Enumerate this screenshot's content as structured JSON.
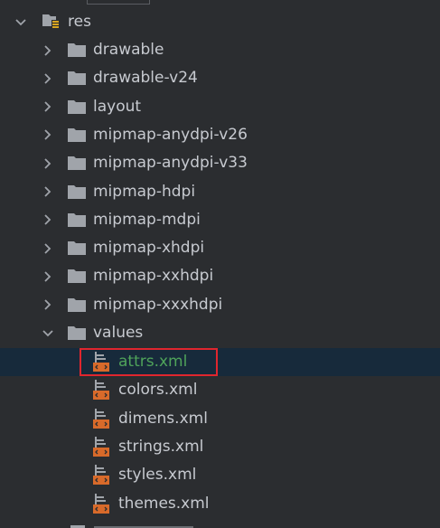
{
  "colors": {
    "background": "#2b2d30",
    "selection": "#172a3b",
    "text": "#c7cad0",
    "selected_text": "#4fa35a",
    "folder": "#a0a4aa",
    "xml_file": "#d86a2a",
    "highlight_border": "#e0262e"
  },
  "tree": {
    "res": {
      "label": "res",
      "expanded": true,
      "icon": "resource-folder-icon"
    },
    "folders": [
      {
        "label": "drawable",
        "expanded": false,
        "icon": "folder-icon"
      },
      {
        "label": "drawable-v24",
        "expanded": false,
        "icon": "folder-icon"
      },
      {
        "label": "layout",
        "expanded": false,
        "icon": "folder-icon"
      },
      {
        "label": "mipmap-anydpi-v26",
        "expanded": false,
        "icon": "folder-icon"
      },
      {
        "label": "mipmap-anydpi-v33",
        "expanded": false,
        "icon": "folder-icon"
      },
      {
        "label": "mipmap-hdpi",
        "expanded": false,
        "icon": "folder-icon"
      },
      {
        "label": "mipmap-mdpi",
        "expanded": false,
        "icon": "folder-icon"
      },
      {
        "label": "mipmap-xhdpi",
        "expanded": false,
        "icon": "folder-icon"
      },
      {
        "label": "mipmap-xxhdpi",
        "expanded": false,
        "icon": "folder-icon"
      },
      {
        "label": "mipmap-xxxhdpi",
        "expanded": false,
        "icon": "folder-icon"
      }
    ],
    "values": {
      "label": "values",
      "expanded": true,
      "icon": "folder-icon",
      "files": [
        {
          "label": "attrs.xml",
          "selected": true,
          "icon": "xml-file-icon"
        },
        {
          "label": "colors.xml",
          "selected": false,
          "icon": "xml-file-icon"
        },
        {
          "label": "dimens.xml",
          "selected": false,
          "icon": "xml-file-icon"
        },
        {
          "label": "strings.xml",
          "selected": false,
          "icon": "xml-file-icon"
        },
        {
          "label": "styles.xml",
          "selected": false,
          "icon": "xml-file-icon"
        },
        {
          "label": "themes.xml",
          "selected": false,
          "icon": "xml-file-icon"
        }
      ]
    }
  }
}
